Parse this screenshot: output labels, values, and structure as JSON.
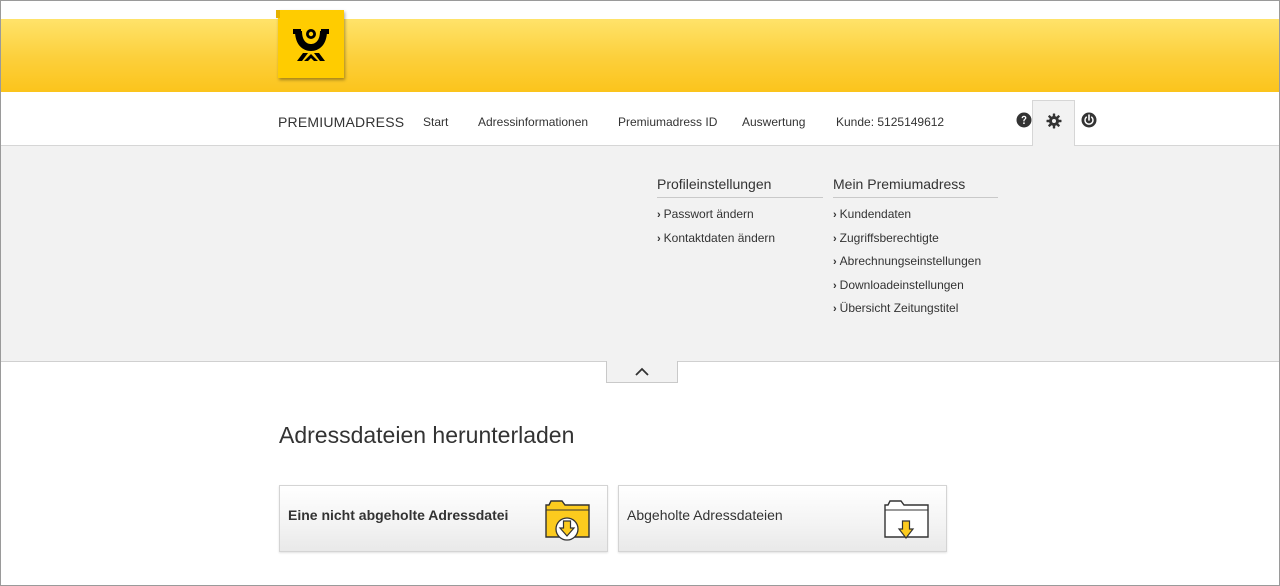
{
  "header": {
    "logo": "deutsche-post-horn-logo",
    "brand_color": "#ffcc00"
  },
  "nav": {
    "brand": "PREMIUMADRESS",
    "items": [
      {
        "label": "Start"
      },
      {
        "label": "Adressinformationen"
      },
      {
        "label": "Premiumadress ID"
      },
      {
        "label": "Auswertung"
      }
    ],
    "customer": "Kunde: 5125149612",
    "icons": [
      "help-icon",
      "gear-icon",
      "power-icon"
    ]
  },
  "settings_menu": {
    "col1": {
      "title": "Profileinstellungen",
      "items": [
        "Passwort ändern",
        "Kontaktdaten ändern"
      ]
    },
    "col2": {
      "title": "Mein Premiumadress",
      "items": [
        "Kundendaten",
        "Zugriffsberechtigte",
        "Abrechnungseinstellungen",
        "Downloadeinstellungen",
        "Übersicht Zeitungstitel"
      ]
    },
    "chevron": "›"
  },
  "main": {
    "title": "Adressdateien herunterladen",
    "tiles": [
      {
        "label": "Eine nicht abgeholte Adressdatei",
        "icon": "folder-download-icon"
      },
      {
        "label": "Abgeholte Adressdateien",
        "icon": "folder-download-empty-icon"
      }
    ]
  }
}
